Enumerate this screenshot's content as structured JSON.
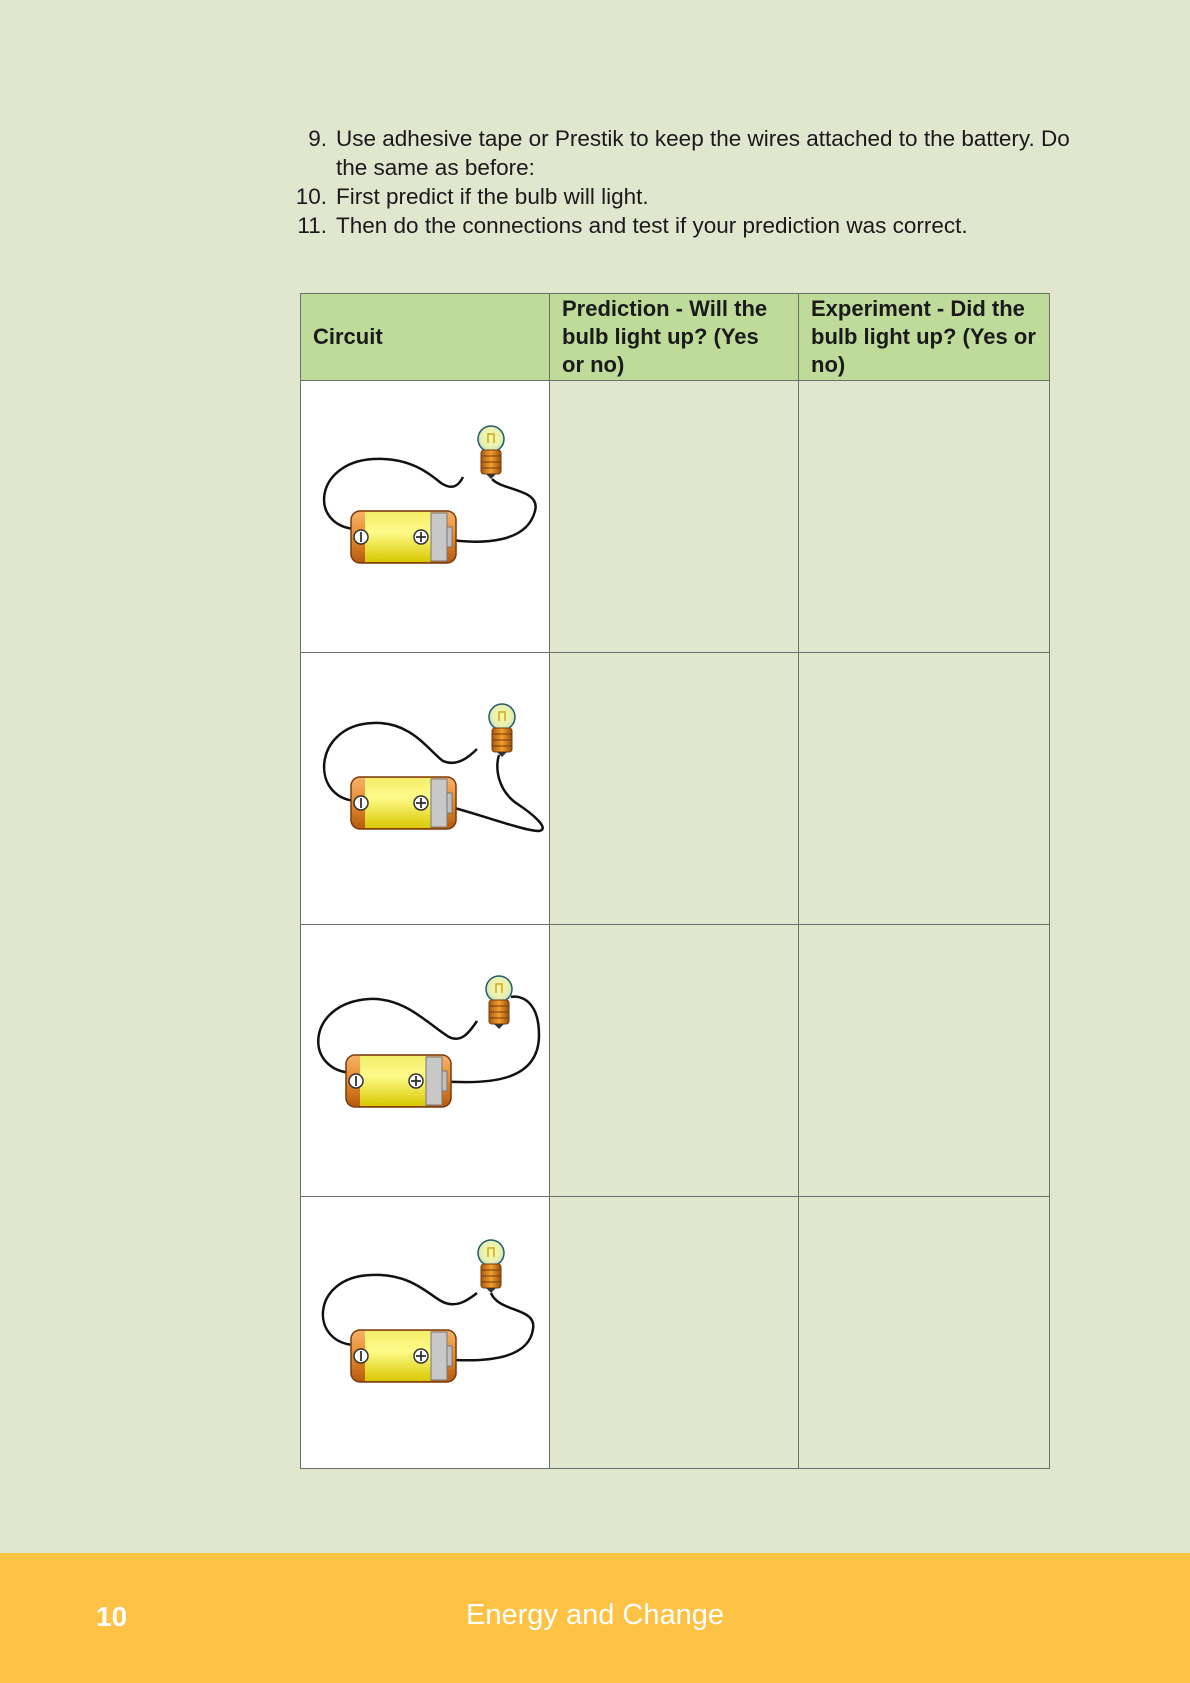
{
  "instructions": [
    {
      "num": "9.",
      "text": "Use adhesive tape or Prestik to keep the wires attached to the battery. Do the same as before:"
    },
    {
      "num": "10.",
      "text": "First predict if the bulb will light."
    },
    {
      "num": "11.",
      "text": "Then do the connections and test if your prediction was correct."
    }
  ],
  "table": {
    "headers": [
      "Circuit",
      "Prediction - Will the bulb light up? (Yes or no)",
      "Experiment - Did the bulb light up? (Yes or no)"
    ]
  },
  "footer": {
    "page_number": "10",
    "book_title": "Energy and Change"
  }
}
